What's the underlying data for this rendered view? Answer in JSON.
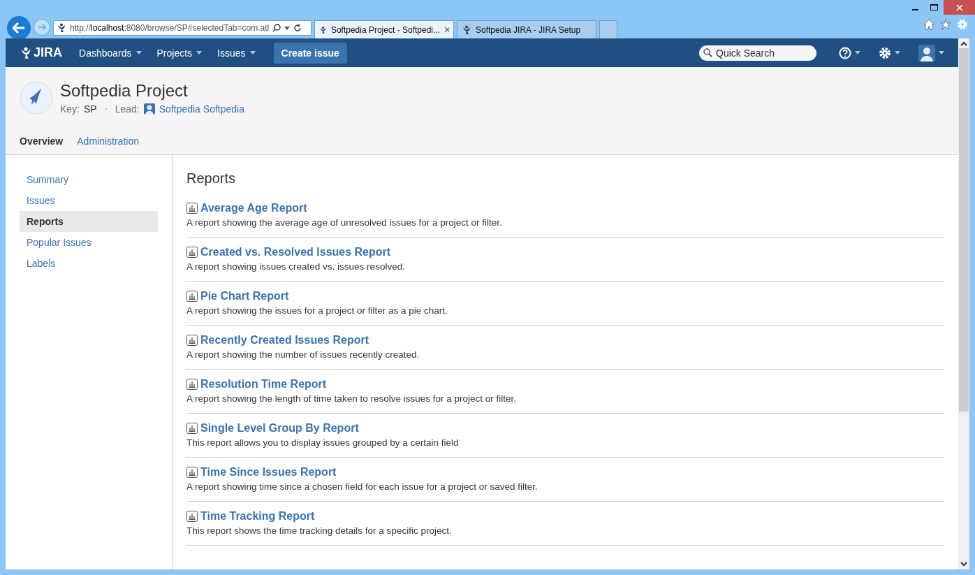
{
  "browser": {
    "address": "http://**localhost**:8080/browse/SP#selectedTab=com.atl",
    "tabs": [
      {
        "label": "Softpedia Project - Softpedi...",
        "selected": true
      },
      {
        "label": "Softpedia JIRA - JIRA Setup",
        "selected": false
      }
    ]
  },
  "header": {
    "logo": "JIRA",
    "menus": [
      "Dashboards",
      "Projects",
      "Issues"
    ],
    "create_button": "Create issue",
    "search": {
      "placeholder": "Quick Search"
    }
  },
  "project": {
    "title": "Softpedia Project",
    "key_label": "Key:",
    "key": "SP",
    "lead_label": "Lead:",
    "lead": "Softpedia Softpedia"
  },
  "project_tabs": [
    {
      "label": "Overview",
      "selected": true
    },
    {
      "label": "Administration",
      "selected": false
    }
  ],
  "sidebar": {
    "items": [
      {
        "label": "Summary",
        "selected": false
      },
      {
        "label": "Issues",
        "selected": false
      },
      {
        "label": "Reports",
        "selected": true
      },
      {
        "label": "Popular Issues",
        "selected": false
      },
      {
        "label": "Labels",
        "selected": false
      }
    ]
  },
  "content": {
    "title": "Reports",
    "reports": [
      {
        "name": "Average Age Report",
        "description": "A report showing the average age of unresolved issues for a project or filter."
      },
      {
        "name": "Created vs. Resolved Issues Report",
        "description": "A report showing issues created vs. issues resolved."
      },
      {
        "name": "Pie Chart Report",
        "description": "A report showing the issues for a project or filter as a pie chart."
      },
      {
        "name": "Recently Created Issues Report",
        "description": "A report showing the number of issues recently created."
      },
      {
        "name": "Resolution Time Report",
        "description": "A report showing the length of time taken to resolve issues for a project or filter."
      },
      {
        "name": "Single Level Group By Report",
        "description": "This report allows you to display issues grouped by a certain field"
      },
      {
        "name": "Time Since Issues Report",
        "description": "A report showing time since a chosen field for each issue for a project or saved filter."
      },
      {
        "name": "Time Tracking Report",
        "description": "This report shows the time tracking details for a specific project."
      }
    ]
  }
}
